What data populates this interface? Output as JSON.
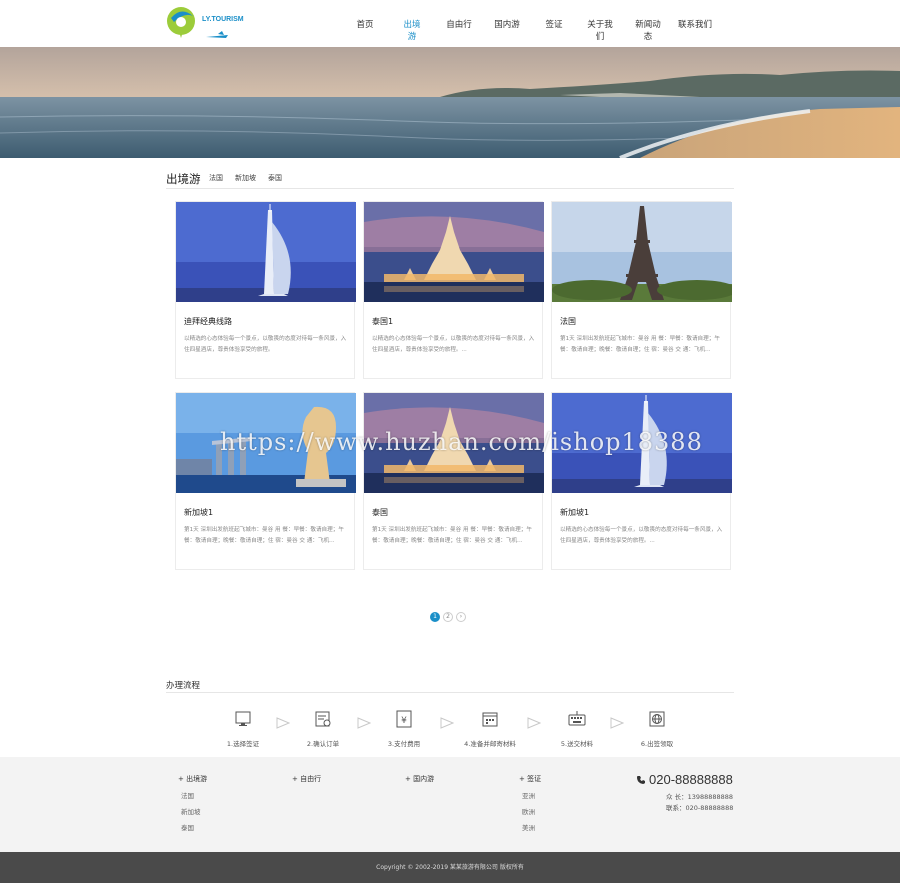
{
  "header": {
    "logo_text": "LY.TOURISM",
    "nav": [
      "首页",
      "出境游",
      "自由行",
      "国内游",
      "签证",
      "关于我们",
      "新闻动态",
      "联系我们"
    ],
    "active_index": 1
  },
  "section": {
    "title": "出境游",
    "tabs": [
      "法国",
      "新加坡",
      "泰国"
    ]
  },
  "cards": [
    {
      "title": "迪拜经典线路",
      "desc": "以精选的心态体验每一个景点，以敬畏的态度对待每一条风景，入住四星酒店，尊贵体验享受的旅程。",
      "scene": "burj"
    },
    {
      "title": "泰国1",
      "desc": "以精选的心态体验每一个景点，以敬畏的态度对待每一条风景，入住四星酒店，尊贵体验享受的旅程。...",
      "scene": "temple"
    },
    {
      "title": "法国",
      "desc": "第1天 深圳出发航班起飞城市：曼谷 用 餐：早餐：敬请自理；午餐：敬请自理；晚餐：敬请自理；住 宿：曼谷 交 通：飞机...",
      "scene": "eiffel"
    },
    {
      "title": "新加坡1",
      "desc": "第1天 深圳出发航班起飞城市：曼谷 用 餐：早餐：敬请自理；午餐：敬请自理；晚餐：敬请自理；住 宿：曼谷 交 通：飞机...",
      "scene": "merlion"
    },
    {
      "title": "泰国",
      "desc": "第1天 深圳出发航班起飞城市：曼谷 用 餐：早餐：敬请自理；午餐：敬请自理；晚餐：敬请自理；住 宿：曼谷 交 通：飞机...",
      "scene": "temple"
    },
    {
      "title": "新加坡1",
      "desc": "以精选的心态体验每一个景点，以敬畏的态度对待每一条风景，入住四星酒店，尊贵体验享受的旅程。...",
      "scene": "burj"
    }
  ],
  "pager": {
    "pages": [
      "1",
      "2"
    ],
    "next": "›",
    "current": 1
  },
  "watermark": "https://www.huzhan.com/ishop18388",
  "process": {
    "title": "办理流程",
    "steps": [
      {
        "label": "1.选择签证",
        "icon": "monitor-icon"
      },
      {
        "label": "2.确认订单",
        "icon": "form-icon"
      },
      {
        "label": "3.支付费用",
        "icon": "yen-icon"
      },
      {
        "label": "4.准备并邮寄材料",
        "icon": "calendar-icon"
      },
      {
        "label": "5.送交材料",
        "icon": "keyboard-icon"
      },
      {
        "label": "6.出签领取",
        "icon": "globe-icon"
      }
    ]
  },
  "footer": {
    "cols": [
      {
        "head": "+ 出境游",
        "items": [
          "法国",
          "新加坡",
          "泰国"
        ]
      },
      {
        "head": "+ 自由行",
        "items": []
      },
      {
        "head": "+ 国内游",
        "items": []
      },
      {
        "head": "+ 签证",
        "items": [
          "亚洲",
          "欧洲",
          "美洲"
        ]
      }
    ],
    "phone": "020-88888888",
    "mobile": "众 长：13988888888",
    "fax": "联系：020-88888888"
  },
  "copyright": "Copyright © 2002-2019 某某旅游有限公司 版权所有",
  "colors": {
    "accent": "#1b8fc8",
    "footer_bg": "#f3f3f3",
    "copyright_bg": "#4a4a4a"
  }
}
